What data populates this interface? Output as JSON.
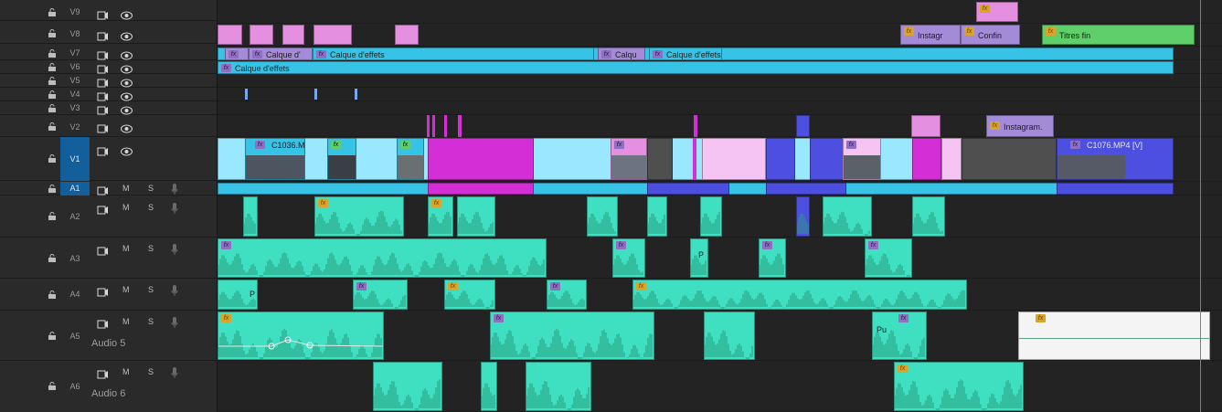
{
  "tracks": {
    "video": [
      {
        "id": "V9"
      },
      {
        "id": "V8"
      },
      {
        "id": "V7"
      },
      {
        "id": "V6"
      },
      {
        "id": "V5"
      },
      {
        "id": "V4"
      },
      {
        "id": "V3"
      },
      {
        "id": "V2"
      },
      {
        "id": "V1",
        "highlighted": true
      }
    ],
    "audio": [
      {
        "id": "A1",
        "highlighted": true,
        "mute": "M",
        "solo": "S"
      },
      {
        "id": "A2",
        "mute": "M",
        "solo": "S"
      },
      {
        "id": "A3",
        "mute": "M",
        "solo": "S"
      },
      {
        "id": "A4",
        "mute": "M",
        "solo": "S"
      },
      {
        "id": "A5",
        "mute": "M",
        "solo": "S",
        "name": "Audio 5"
      },
      {
        "id": "A6",
        "mute": "M",
        "solo": "S",
        "name": "Audio 6"
      }
    ]
  },
  "clips": {
    "v8_instagram": "Instagr",
    "v8_confin": "Confin",
    "v8_titres": "Titres fin",
    "v7_calque1": "Calque d'",
    "v7_calque2": "Calque d'effets",
    "v7_calque3": "Calqu",
    "v7_calque4": "Calque d'effets",
    "v6_calque": "Calque d'effets",
    "v2_instagram": "Instagram.",
    "v1_c1036": "C1036.M",
    "v1_c1076": "C1076.MP4 [V]",
    "a5_p": "Pu",
    "a4_p": "P",
    "a3_p": "P"
  },
  "colors": {
    "pink": "#e48fe0",
    "cyan": "#36c3e6",
    "purple": "#a48bd8",
    "green": "#5fcf6a",
    "magenta": "#d42ed6",
    "teal": "#3fe0c1",
    "blue": "#4c4fe0",
    "lightpink": "#f6c4f2",
    "lightcyan": "#9ae8ff",
    "playhead": "#3d8fd6"
  }
}
